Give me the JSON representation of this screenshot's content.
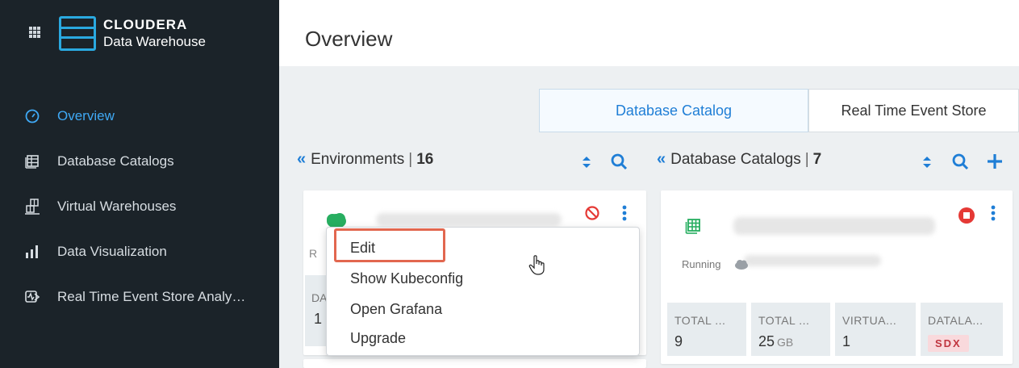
{
  "app": {
    "brand": "CLOUDERA",
    "product": "Data Warehouse"
  },
  "sidebar": {
    "items": [
      {
        "label": "Overview",
        "icon": "gauge-icon",
        "active": true
      },
      {
        "label": "Database Catalogs",
        "icon": "table-icon"
      },
      {
        "label": "Virtual Warehouses",
        "icon": "warehouse-icon"
      },
      {
        "label": "Data Visualization",
        "icon": "bar-chart-icon"
      },
      {
        "label": "Real Time Event Store Analy…",
        "icon": "event-store-icon"
      }
    ]
  },
  "header": {
    "title": "Overview"
  },
  "tabs": [
    {
      "label": "Database Catalog",
      "active": true
    },
    {
      "label": "Real Time Event Store",
      "active": false
    }
  ],
  "environments": {
    "label": "Environments",
    "separator": "|",
    "count": "16",
    "card": {
      "status_partial": "R",
      "stat_label_partial": "DA",
      "stat_value_partial": "1"
    }
  },
  "database_catalogs": {
    "label": "Database Catalogs",
    "separator": "|",
    "count": "7",
    "card": {
      "status": "Running",
      "stats": [
        {
          "label": "TOTAL ...",
          "value": "9",
          "unit": ""
        },
        {
          "label": "TOTAL ...",
          "value": "25",
          "unit": "GB"
        },
        {
          "label": "VIRTUA...",
          "value": "1",
          "unit": ""
        },
        {
          "label": "DATALA...",
          "badge": "SDX"
        }
      ]
    }
  },
  "context_menu": {
    "items": [
      "Edit",
      "Show Kubeconfig",
      "Open Grafana",
      "Upgrade"
    ],
    "highlighted": "Edit"
  },
  "colors": {
    "sidebar_bg": "#1b2329",
    "accent_blue": "#1f7ed6",
    "logo_blue": "#2aa9e0",
    "running_green": "#27ae60",
    "stop_red": "#e53935",
    "highlight_border": "#e2674f"
  }
}
